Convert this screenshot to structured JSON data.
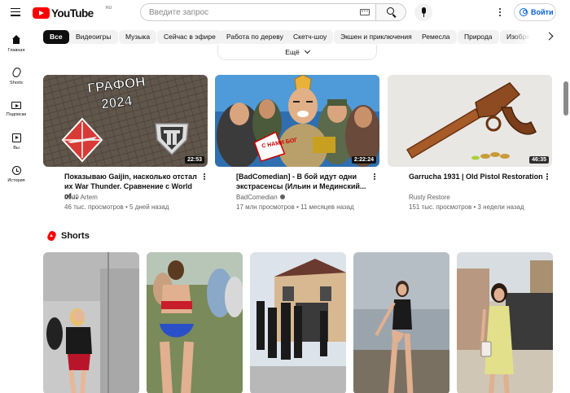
{
  "header": {
    "logo_text": "YouTube",
    "logo_region": "RU",
    "search_placeholder": "Введите запрос",
    "signin_label": "Войти"
  },
  "sidebar": {
    "items": [
      {
        "label": "Главная",
        "icon": "home-icon"
      },
      {
        "label": "Shorts",
        "icon": "shorts-icon"
      },
      {
        "label": "Подписки",
        "icon": "subscriptions-icon"
      },
      {
        "label": "Вы",
        "icon": "you-icon"
      },
      {
        "label": "История",
        "icon": "history-icon"
      }
    ]
  },
  "chips": [
    {
      "label": "Все",
      "active": true
    },
    {
      "label": "Видеоигры"
    },
    {
      "label": "Музыка"
    },
    {
      "label": "Сейчас в эфире"
    },
    {
      "label": "Работа по дереву"
    },
    {
      "label": "Скетч-шоу"
    },
    {
      "label": "Экшен и приключения"
    },
    {
      "label": "Ремесла"
    },
    {
      "label": "Природа"
    },
    {
      "label": "Изобразительное искусство"
    }
  ],
  "more_label": "Ещё",
  "videos": [
    {
      "title": "Показываю Gaijin, насколько отстал их War Thunder. Сравнение с World of...",
      "channel": "d9d9 Artem",
      "meta": "46 тыс. просмотров • 5 дней назад",
      "duration": "22:53",
      "thumb_text_1": "ГРАФОН",
      "thumb_text_2": "2024"
    },
    {
      "title": "[BadComedian] - В бой идут одни экстрасенсы (Ильин и Мединский...",
      "channel": "BadComedian",
      "meta": "17 млн просмотров • 11 месяцев назад",
      "duration": "2:22:24",
      "thumb_text_1": "С НАМИ БОГ"
    },
    {
      "title": "Garrucha 1931 | Old Pistol Restoration",
      "channel": "Rusty Restore",
      "meta": "151 тыс. просмотров • 3 недели назад",
      "duration": "46:35"
    }
  ],
  "shorts": {
    "title": "Shorts"
  },
  "colors": {
    "brand_red": "#ff0000",
    "link_blue": "#065fd4",
    "chip_bg": "#f2f2f2"
  }
}
